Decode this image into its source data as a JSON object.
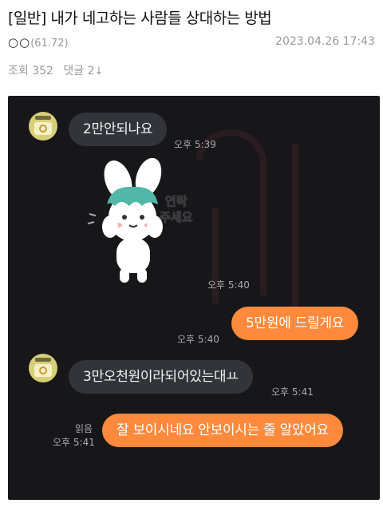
{
  "post": {
    "title": "[일반] 내가 네고하는 사람들 상대하는 방법",
    "author_nick": "○○",
    "author_level": "(61.72)",
    "date": "2023.04.26 17:43",
    "views_label": "조회",
    "views": "352",
    "comments_label": "댓글",
    "comments": "2",
    "comments_arrow": "↓"
  },
  "chat": {
    "background": "#17171a",
    "incoming_color": "#33343a",
    "outgoing_color": "#ff8a3d",
    "messages": [
      {
        "text": "2만안되나요",
        "time": "오후 5:39"
      },
      {
        "sticker_text_1": "연락",
        "sticker_text_2": "주세요",
        "time": "오후 5:40"
      },
      {
        "text": "5만원에 드릴게요",
        "time": "오후 5:40"
      },
      {
        "text": "3만오천원이라되어있는대ㅛ",
        "time": "오후 5:41"
      },
      {
        "text": "잘 보이시네요 안보이시는 줄 알았어요",
        "read": "읽음",
        "time": "오후 5:41"
      }
    ]
  }
}
